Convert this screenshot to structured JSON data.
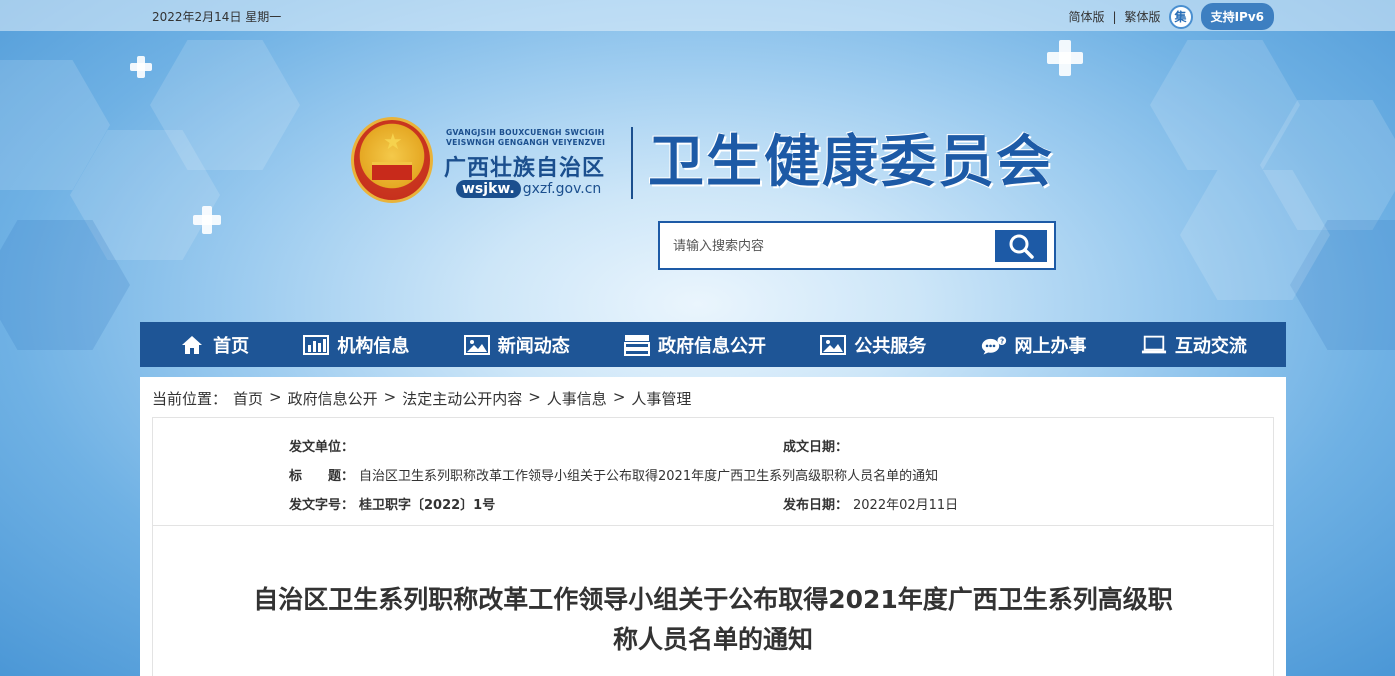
{
  "topbar": {
    "date": "2022年2月14日 星期一",
    "simplified": "简体版",
    "divider": "|",
    "traditional": "繁体版",
    "elder_icon_label": "集",
    "ipv6": "支持IPv6"
  },
  "logo": {
    "zhuang_line1": "GVANGJSIH BOUXCUENGH SWCIGIH",
    "zhuang_line2": "VEISWNGH GENGANGH VEIYENZVEI",
    "region": "广西壮族自治区",
    "domain_prefix": "wsjkw.",
    "domain_suffix": "gxzf.gov.cn",
    "main_title": "卫生健康委员会"
  },
  "search": {
    "placeholder": "请输入搜索内容"
  },
  "nav": {
    "items": [
      {
        "label": "首页",
        "icon": "home-icon"
      },
      {
        "label": "机构信息",
        "icon": "bar-chart-icon"
      },
      {
        "label": "新闻动态",
        "icon": "image-icon"
      },
      {
        "label": "政府信息公开",
        "icon": "server-icon"
      },
      {
        "label": "公共服务",
        "icon": "picture-icon"
      },
      {
        "label": "网上办事",
        "icon": "chat-icon"
      },
      {
        "label": "互动交流",
        "icon": "laptop-icon"
      }
    ]
  },
  "breadcrumb": {
    "prefix": "当前位置：",
    "items": [
      "首页",
      "政府信息公开",
      "法定主动公开内容",
      "人事信息",
      "人事管理"
    ],
    "separator": ">"
  },
  "meta": {
    "issuer_label": "发文单位：",
    "issuer_value": "",
    "date_written_label": "成文日期：",
    "date_written_value": "",
    "title_label": "标　　题：",
    "title_value": "自治区卫生系列职称改革工作领导小组关于公布取得2021年度广西卫生系列高级职称人员名单的通知",
    "doc_no_label": "发文字号：",
    "doc_no_value": "桂卫职字〔2022〕1号",
    "publish_label": "发布日期：",
    "publish_value": "2022年02月11日"
  },
  "document": {
    "title_line1": "自治区卫生系列职称改革工作领导小组关于公布取得2021年度广西卫生系列高级职",
    "title_line2": "称人员名单的通知"
  },
  "colors": {
    "nav_bg": "#1e5596",
    "brand_blue": "#1d5aa6",
    "ipv6_bg": "#3d7fc1"
  }
}
